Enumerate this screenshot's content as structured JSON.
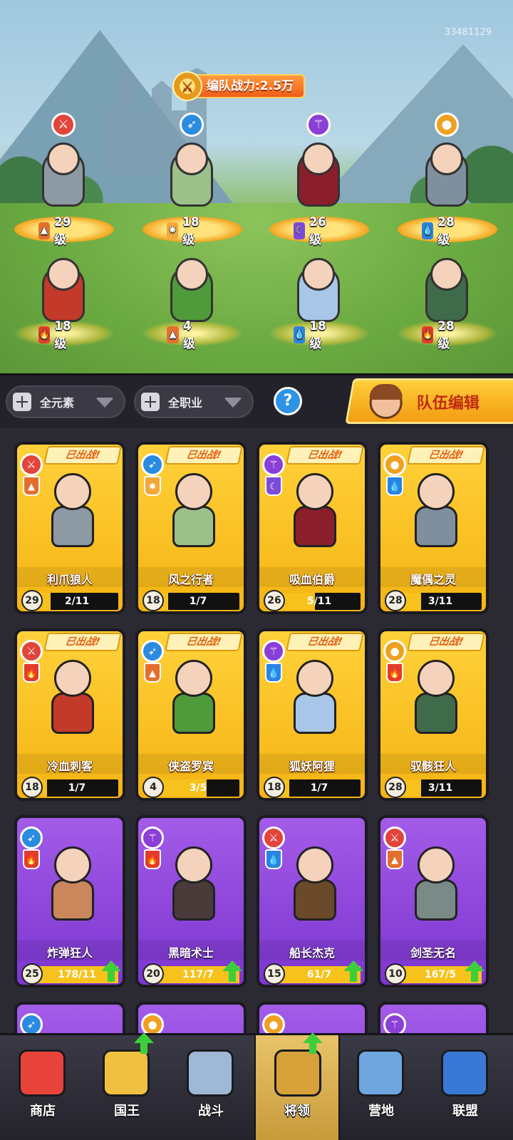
{
  "scene": {
    "uid": "33481129",
    "power_label": "编队战力:2.5万",
    "power_icon": "sword-emblem-icon",
    "lineup": [
      {
        "name": "利爪狼人",
        "class": "warrior",
        "class_icon": "sword-icon",
        "class_glyph": "⚔",
        "element": "earth",
        "element_glyph": "▲",
        "level": "29级",
        "color": "#8d9aa3"
      },
      {
        "name": "风之行者",
        "class": "ranger",
        "class_icon": "bow-icon",
        "class_glyph": "➶",
        "element": "light",
        "element_glyph": "✸",
        "level": "18级",
        "color": "#9cc08a"
      },
      {
        "name": "吸血伯爵",
        "class": "mage",
        "class_icon": "staff-icon",
        "class_glyph": "⚚",
        "element": "moon",
        "element_glyph": "☾",
        "level": "26级",
        "color": "#8a1f2b"
      },
      {
        "name": "魔偶之灵",
        "class": "support",
        "class_icon": "bomb-icon",
        "class_glyph": "●",
        "element": "water",
        "element_glyph": "💧",
        "level": "28级",
        "color": "#7f8f9e"
      },
      {
        "name": "冷血刺客",
        "class": "warrior",
        "class_icon": "sword-icon",
        "class_glyph": "⚔",
        "element": "fire",
        "element_glyph": "🔥",
        "level": "18级",
        "color": "#c43a2a"
      },
      {
        "name": "侠盗罗宾",
        "class": "ranger",
        "class_icon": "bow-icon",
        "class_glyph": "➶",
        "element": "earth",
        "element_glyph": "▲",
        "level": "4级",
        "color": "#4f9a3b"
      },
      {
        "name": "狐妖阿狸",
        "class": "mage",
        "class_icon": "staff-icon",
        "class_glyph": "⚚",
        "element": "water",
        "element_glyph": "💧",
        "level": "18级",
        "color": "#a8c7e8"
      },
      {
        "name": "驭骸狂人",
        "class": "support",
        "class_icon": "bomb-icon",
        "class_glyph": "●",
        "element": "fire",
        "element_glyph": "🔥",
        "level": "28级",
        "color": "#3f6b4a"
      }
    ]
  },
  "filters": {
    "element_label": "全元素",
    "class_label": "全职业",
    "help_glyph": "?",
    "team_edit_label": "队伍编辑"
  },
  "roster": {
    "deployed_label": "已出战!",
    "cards": [
      {
        "name": "利爪狼人",
        "level": "29",
        "progress": "2/11",
        "fill": 0.18,
        "tier": "gold",
        "class": "warrior",
        "class_glyph": "⚔",
        "element": "earth",
        "element_glyph": "▲",
        "deployed": true,
        "upgrade": false,
        "color": "#8d9aa3"
      },
      {
        "name": "风之行者",
        "level": "18",
        "progress": "1/7",
        "fill": 0.14,
        "tier": "gold",
        "class": "ranger",
        "class_glyph": "➶",
        "element": "light",
        "element_glyph": "✸",
        "deployed": true,
        "upgrade": false,
        "color": "#9cc08a"
      },
      {
        "name": "吸血伯爵",
        "level": "26",
        "progress": "5/11",
        "fill": 0.45,
        "tier": "gold",
        "class": "mage",
        "class_glyph": "⚚",
        "element": "moon",
        "element_glyph": "☾",
        "deployed": true,
        "upgrade": false,
        "color": "#8a1f2b"
      },
      {
        "name": "魔偶之灵",
        "level": "28",
        "progress": "3/11",
        "fill": 0.27,
        "tier": "gold",
        "class": "support",
        "class_glyph": "●",
        "element": "water",
        "element_glyph": "💧",
        "deployed": true,
        "upgrade": false,
        "color": "#7f8f9e"
      },
      {
        "name": "冷血刺客",
        "level": "18",
        "progress": "1/7",
        "fill": 0.14,
        "tier": "gold",
        "class": "warrior",
        "class_glyph": "⚔",
        "element": "fire",
        "element_glyph": "🔥",
        "deployed": true,
        "upgrade": false,
        "color": "#c43a2a"
      },
      {
        "name": "侠盗罗宾",
        "level": "4",
        "progress": "3/5",
        "fill": 0.6,
        "tier": "gold",
        "class": "ranger",
        "class_glyph": "➶",
        "element": "earth",
        "element_glyph": "▲",
        "deployed": true,
        "upgrade": false,
        "color": "#4f9a3b"
      },
      {
        "name": "狐妖阿狸",
        "level": "18",
        "progress": "1/7",
        "fill": 0.14,
        "tier": "gold",
        "class": "mage",
        "class_glyph": "⚚",
        "element": "water",
        "element_glyph": "💧",
        "deployed": true,
        "upgrade": false,
        "color": "#a8c7e8"
      },
      {
        "name": "驭骸狂人",
        "level": "28",
        "progress": "3/11",
        "fill": 0.27,
        "tier": "gold",
        "class": "support",
        "class_glyph": "●",
        "element": "fire",
        "element_glyph": "🔥",
        "deployed": true,
        "upgrade": false,
        "color": "#3f6b4a"
      },
      {
        "name": "炸弹狂人",
        "level": "25",
        "progress": "178/11",
        "fill": 1,
        "tier": "purple",
        "class": "ranger",
        "class_glyph": "➶",
        "element": "fire",
        "element_glyph": "🔥",
        "deployed": false,
        "upgrade": true,
        "color": "#c9875b"
      },
      {
        "name": "黑暗术士",
        "level": "20",
        "progress": "117/7",
        "fill": 1,
        "tier": "purple",
        "class": "mage",
        "class_glyph": "⚚",
        "element": "fire",
        "element_glyph": "🔥",
        "deployed": false,
        "upgrade": true,
        "color": "#4a3a3a"
      },
      {
        "name": "船长杰克",
        "level": "15",
        "progress": "61/7",
        "fill": 1,
        "tier": "purple",
        "class": "warrior",
        "class_glyph": "⚔",
        "element": "water",
        "element_glyph": "💧",
        "deployed": false,
        "upgrade": true,
        "color": "#6a4a2a"
      },
      {
        "name": "剑圣无名",
        "level": "10",
        "progress": "167/5",
        "fill": 1,
        "tier": "purple",
        "class": "warrior",
        "class_glyph": "⚔",
        "element": "earth",
        "element_glyph": "▲",
        "deployed": false,
        "upgrade": true,
        "color": "#7a8a86"
      },
      {
        "name": "",
        "level": "",
        "progress": "",
        "fill": 0,
        "tier": "purple",
        "class": "ranger",
        "class_glyph": "➶",
        "element": "",
        "element_glyph": "",
        "deployed": false,
        "upgrade": false,
        "color": "#7c35cf"
      },
      {
        "name": "",
        "level": "",
        "progress": "",
        "fill": 0,
        "tier": "purple",
        "class": "support",
        "class_glyph": "●",
        "element": "",
        "element_glyph": "",
        "deployed": false,
        "upgrade": false,
        "color": "#7c35cf"
      },
      {
        "name": "",
        "level": "",
        "progress": "",
        "fill": 0,
        "tier": "purple",
        "class": "support",
        "class_glyph": "●",
        "element": "",
        "element_glyph": "",
        "deployed": false,
        "upgrade": false,
        "color": "#7c35cf"
      },
      {
        "name": "",
        "level": "",
        "progress": "",
        "fill": 0,
        "tier": "purple",
        "class": "mage",
        "class_glyph": "⚚",
        "element": "",
        "element_glyph": "",
        "deployed": false,
        "upgrade": false,
        "color": "#7c35cf"
      }
    ]
  },
  "nav": {
    "items": [
      {
        "label": "商店",
        "icon": "shop-icon",
        "color": "#e8433b",
        "active": false,
        "badge": false
      },
      {
        "label": "国王",
        "icon": "king-icon",
        "color": "#f0c040",
        "active": false,
        "badge": true
      },
      {
        "label": "战斗",
        "icon": "sword-icon",
        "color": "#9fb8d6",
        "active": false,
        "badge": false
      },
      {
        "label": "将领",
        "icon": "helmet-icon",
        "color": "#d7a13a",
        "active": true,
        "badge": true
      },
      {
        "label": "营地",
        "icon": "castle-icon",
        "color": "#6fa6e0",
        "active": false,
        "badge": false
      },
      {
        "label": "联盟",
        "icon": "shield-icon",
        "color": "#3a78d6",
        "active": false,
        "badge": false
      }
    ]
  }
}
